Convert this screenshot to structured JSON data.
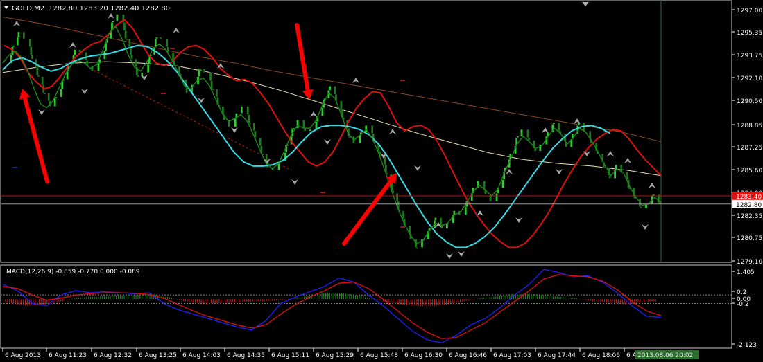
{
  "header": {
    "symbol": "GOLD,M2",
    "ohlc": "1282.80 1283.20 1282.40 1282.80"
  },
  "colors": {
    "background": "#000000",
    "axis": "#ffffff",
    "bull": "#2ecc2e",
    "bear": "#1f7a1f",
    "ma_red": "#e01010",
    "ma_green": "#1a8a1a",
    "ma_cyan": "#33dde8",
    "ma_brown": "#8a4a22",
    "ma_ivory": "#e6e0b0",
    "price_line": "#b01818",
    "bid_line": "#9a9a9a",
    "arrow": "#ff0000",
    "grid_dots": "#888888",
    "cursor_line": "#2f6a2f",
    "macd_main": "#2020ff",
    "macd_signal": "#e01010",
    "hist_up": "#1e8a1e",
    "hist_down": "#c81e1e"
  },
  "price_labels": {
    "ask": "1283.40",
    "bid": "1282.80"
  },
  "macd": {
    "title": "MACD(12,26,9) -0.859 -0.770 0.000 -0.089",
    "levels": [
      "0.2",
      "0.00",
      "-0.2"
    ]
  },
  "footer": {
    "time_highlight": "2013.08.06 20:02"
  },
  "chart_data": [
    {
      "type": "line",
      "title": "GOLD,M2",
      "ylim": [
        1278.5,
        1297.8
      ],
      "y_ticks": [
        "1297.00",
        "1295.35",
        "1293.75",
        "1292.10",
        "1290.50",
        "1288.85",
        "1287.25",
        "1285.60",
        "1284.00",
        "1282.35",
        "1280.75",
        "1279.10"
      ],
      "x_ticks": [
        "6 Aug 2013",
        "6 Aug 11:23",
        "6 Aug 12:32",
        "6 Aug 13:25",
        "6 Aug 14:03",
        "6 Aug 14:35",
        "6 Aug 15:11",
        "6 Aug 15:29",
        "6 Aug 15:48",
        "6 Aug 16:30",
        "6 Aug 16:46",
        "6 Aug 17:03",
        "6 Aug 17:44",
        "6 Aug 18:06",
        "6 A"
      ],
      "series": [
        {
          "name": "",
          "kind": "price",
          "values": [
            1293.2,
            1294.5,
            1295.5,
            1295.0,
            1293.5,
            1292.2,
            1291.0,
            1290.0,
            1290.7,
            1292.0,
            1293.2,
            1294.2,
            1294.0,
            1293.0,
            1292.6,
            1293.5,
            1295.0,
            1296.3,
            1296.8,
            1295.0,
            1293.5,
            1292.2,
            1292.5,
            1293.8,
            1295.1,
            1295.0,
            1294.0,
            1293.0,
            1292.0,
            1291.0,
            1291.6,
            1292.8,
            1292.5,
            1291.3,
            1290.0,
            1289.0,
            1288.5,
            1289.5,
            1290.0,
            1288.8,
            1287.7,
            1286.5,
            1285.5,
            1285.3,
            1286.0,
            1287.2,
            1288.4,
            1289.0,
            1288.2,
            1288.3,
            1289.3,
            1290.6,
            1291.5,
            1290.4,
            1289.0,
            1287.8,
            1287.3,
            1288.1,
            1288.6,
            1287.3,
            1286.3,
            1285.0,
            1283.6,
            1282.3,
            1281.2,
            1280.2,
            1279.6,
            1280.2,
            1281.0,
            1281.8,
            1281.0,
            1281.4,
            1282.3,
            1282.0,
            1283.0,
            1284.0,
            1284.5,
            1283.5,
            1283.0,
            1284.0,
            1285.5,
            1286.5,
            1287.8,
            1288.3,
            1287.5,
            1286.7,
            1287.2,
            1288.1,
            1288.8,
            1288.0,
            1287.0,
            1288.0,
            1288.8,
            1288.2,
            1287.3,
            1286.5,
            1285.5,
            1284.7,
            1285.7,
            1285.2,
            1284.0,
            1283.2,
            1282.5,
            1282.8,
            1283.5,
            1282.8
          ]
        },
        {
          "name": "",
          "kind": "ma",
          "color_key": "ma_red",
          "values": [
            1294.5,
            1294.2,
            1293.6,
            1292.5,
            1291.8,
            1291.3,
            1291.5,
            1292.2,
            1293.0,
            1293.7,
            1294.2,
            1294.6,
            1294.8,
            1295.3,
            1296.0,
            1296.4,
            1295.8,
            1294.8,
            1293.8,
            1293.2,
            1293.0,
            1293.3,
            1294.0,
            1294.4,
            1294.5,
            1294.2,
            1293.6,
            1292.8,
            1292.3,
            1291.9,
            1292.0,
            1291.7,
            1291.0,
            1290.2,
            1289.2,
            1288.2,
            1287.3,
            1286.6,
            1285.9,
            1285.6,
            1285.9,
            1286.6,
            1287.7,
            1288.9,
            1289.9,
            1290.6,
            1291.1,
            1291.0,
            1290.0,
            1288.8,
            1288.2,
            1288.5,
            1288.6,
            1288.3,
            1287.5,
            1286.4,
            1285.2,
            1284.0,
            1282.9,
            1282.0,
            1281.2,
            1280.5,
            1280.0,
            1279.6,
            1279.6,
            1279.9,
            1280.5,
            1281.3,
            1282.2,
            1283.3,
            1284.4,
            1285.4,
            1286.3,
            1287.0,
            1287.6,
            1288.0,
            1288.3,
            1288.2,
            1287.6,
            1286.8,
            1286.1,
            1285.5,
            1284.9
          ]
        },
        {
          "name": "",
          "kind": "ma",
          "color_key": "ma_cyan",
          "values": [
            1292.7,
            1293.4,
            1293.6,
            1293.3,
            1292.9,
            1292.6,
            1292.8,
            1293.2,
            1293.5,
            1293.7,
            1293.8,
            1293.9,
            1294.1,
            1294.3,
            1294.5,
            1294.4,
            1294.0,
            1293.4,
            1292.6,
            1291.6,
            1290.6,
            1289.6,
            1288.6,
            1287.6,
            1286.6,
            1285.9,
            1285.6,
            1285.6,
            1285.7,
            1286.0,
            1286.6,
            1287.4,
            1288.1,
            1288.5,
            1288.6,
            1288.6,
            1288.5,
            1288.3,
            1287.9,
            1287.2,
            1286.2,
            1285.0,
            1283.8,
            1282.6,
            1281.5,
            1280.6,
            1280.0,
            1279.6,
            1279.6,
            1279.9,
            1280.4,
            1281.1,
            1282.0,
            1283.0,
            1284.0,
            1285.0,
            1286.0,
            1286.9,
            1287.6,
            1288.2,
            1288.5,
            1288.6,
            1288.4,
            1288.0
          ]
        },
        {
          "name": "",
          "kind": "ma",
          "color_key": "ma_green",
          "values": [
            1293.2,
            1293.8,
            1294.1,
            1293.6,
            1292.6,
            1291.3,
            1290.2,
            1289.9,
            1290.4,
            1291.4,
            1292.4,
            1293.1,
            1293.4,
            1293.2,
            1292.8,
            1293.1,
            1294.2,
            1295.4,
            1295.9,
            1295.0,
            1293.8,
            1292.9,
            1292.6,
            1293.3,
            1294.3,
            1294.6,
            1294.2,
            1293.4,
            1292.5,
            1291.5,
            1291.3,
            1291.9,
            1292.1,
            1291.5,
            1290.5,
            1289.5,
            1288.9,
            1289.1,
            1289.4,
            1288.9,
            1287.9,
            1286.8,
            1285.8,
            1285.4,
            1285.8,
            1286.8,
            1287.9,
            1288.6,
            1288.4,
            1288.4,
            1289.0,
            1290.1,
            1291.0,
            1290.6,
            1289.4,
            1288.1,
            1287.5,
            1287.9,
            1288.3,
            1287.6,
            1286.5,
            1285.2,
            1283.8,
            1282.5,
            1281.4,
            1280.5,
            1279.9,
            1280.1,
            1280.8,
            1281.4,
            1281.2,
            1281.4,
            1282.0,
            1282.2,
            1282.9,
            1283.7,
            1284.2,
            1283.8,
            1283.4,
            1283.9,
            1285.1,
            1286.1,
            1287.2,
            1287.8,
            1287.4,
            1286.9,
            1287.1,
            1287.8,
            1288.4,
            1288.0,
            1287.2,
            1287.7,
            1288.4,
            1288.1,
            1287.4,
            1286.6,
            1285.7,
            1284.9,
            1285.4,
            1285.1,
            1284.1,
            1283.3,
            1282.7,
            1282.8,
            1283.3,
            1282.9
          ]
        },
        {
          "name": "",
          "kind": "ma",
          "color_key": "ma_brown",
          "values": [
            1296.6,
            1296.1,
            1295.5,
            1294.9,
            1294.3,
            1293.7,
            1293.2,
            1292.6,
            1292.1,
            1291.6,
            1291.1,
            1290.6,
            1290.1,
            1289.6,
            1289.1,
            1288.6,
            1288.1,
            1287.4
          ]
        },
        {
          "name": "",
          "kind": "ma",
          "color_key": "ma_ivory",
          "values": [
            1292.5,
            1292.9,
            1293.2,
            1293.3,
            1293.2,
            1293.0,
            1292.5,
            1291.9,
            1291.2,
            1290.4,
            1289.6,
            1288.8,
            1288.0,
            1287.3,
            1286.6,
            1286.1,
            1285.8,
            1285.6,
            1285.3,
            1284.9
          ]
        }
      ],
      "horizontal_lines": [
        1283.4,
        1282.8
      ]
    },
    {
      "type": "bar",
      "title": "MACD(12,26,9) -0.859 -0.770 0.000 -0.089",
      "ylim": [
        -2.3,
        1.6
      ],
      "y_ticks": [
        "1.405",
        "0.2",
        "0.00",
        "-0.2",
        "-2.123"
      ],
      "series": [
        {
          "name": "",
          "kind": "histogram",
          "values": [
            -0.15,
            -0.25,
            -0.3,
            -0.28,
            -0.2,
            -0.1,
            0.05,
            0.1,
            0.12,
            0.15,
            0.18,
            0.2,
            0.22,
            0.2,
            0.1,
            -0.05,
            -0.15,
            -0.22,
            -0.2,
            -0.18,
            -0.15,
            -0.12,
            -0.1,
            -0.08,
            -0.05,
            0.05,
            0.15,
            0.25,
            0.3,
            0.28,
            0.2,
            0.1,
            -0.05,
            -0.15,
            -0.25,
            -0.3,
            -0.32,
            -0.3,
            -0.25,
            -0.15,
            -0.05,
            0.05,
            0.12,
            0.18,
            0.22,
            0.25,
            0.22,
            0.15,
            0.1,
            0.05,
            -0.05,
            -0.12,
            -0.18,
            -0.22,
            -0.2,
            -0.15,
            -0.1
          ]
        },
        {
          "name": "",
          "kind": "main",
          "values": [
            0.7,
            0.4,
            -0.2,
            -0.3,
            0.2,
            0.4,
            0.3,
            0.35,
            0.3,
            0.25,
            0.3,
            -0.2,
            -0.5,
            -0.7,
            -0.9,
            -1.1,
            -1.3,
            -1.45,
            -1.0,
            -0.2,
            0.1,
            0.35,
            0.6,
            1.0,
            0.8,
            0.2,
            -0.3,
            -0.9,
            -1.5,
            -1.9,
            -2.05,
            -1.7,
            -1.2,
            -0.9,
            -0.4,
            0.2,
            0.7,
            1.4,
            1.25,
            1.05,
            1.1,
            0.8,
            0.3,
            -0.3,
            -0.8,
            -0.86
          ]
        },
        {
          "name": "",
          "kind": "signal",
          "values": [
            0.6,
            0.5,
            0.2,
            -0.05,
            0.05,
            0.2,
            0.25,
            0.3,
            0.3,
            0.28,
            0.22,
            0.05,
            -0.25,
            -0.55,
            -0.8,
            -1.0,
            -1.2,
            -1.35,
            -1.2,
            -0.7,
            -0.25,
            0.1,
            0.4,
            0.75,
            0.8,
            0.5,
            0.0,
            -0.55,
            -1.1,
            -1.55,
            -1.85,
            -1.8,
            -1.45,
            -1.1,
            -0.6,
            -0.1,
            0.4,
            0.95,
            1.15,
            1.1,
            1.05,
            0.85,
            0.45,
            -0.1,
            -0.55,
            -0.77
          ]
        }
      ]
    }
  ]
}
